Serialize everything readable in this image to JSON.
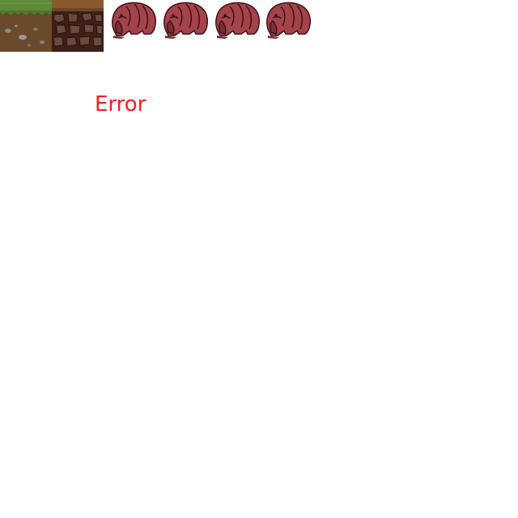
{
  "message": {
    "text": "Error",
    "color": "#ff1a1a"
  },
  "tiles": [
    {
      "name": "grass-dirt-tile",
      "top_color": "#5f8a3a",
      "soil_color": "#6b4a2b",
      "stone_color": "#8c8c8c"
    },
    {
      "name": "rock-dirt-tile",
      "top_color": "#8a5a2e",
      "soil_color": "#3e1f18",
      "rock_color": "#6a4a3c"
    }
  ],
  "sprites": {
    "count": 4,
    "name": "red-mole-creature",
    "body_color": "#a5424a",
    "shade_color": "#7c2d35",
    "outline_color": "#3a1418"
  }
}
